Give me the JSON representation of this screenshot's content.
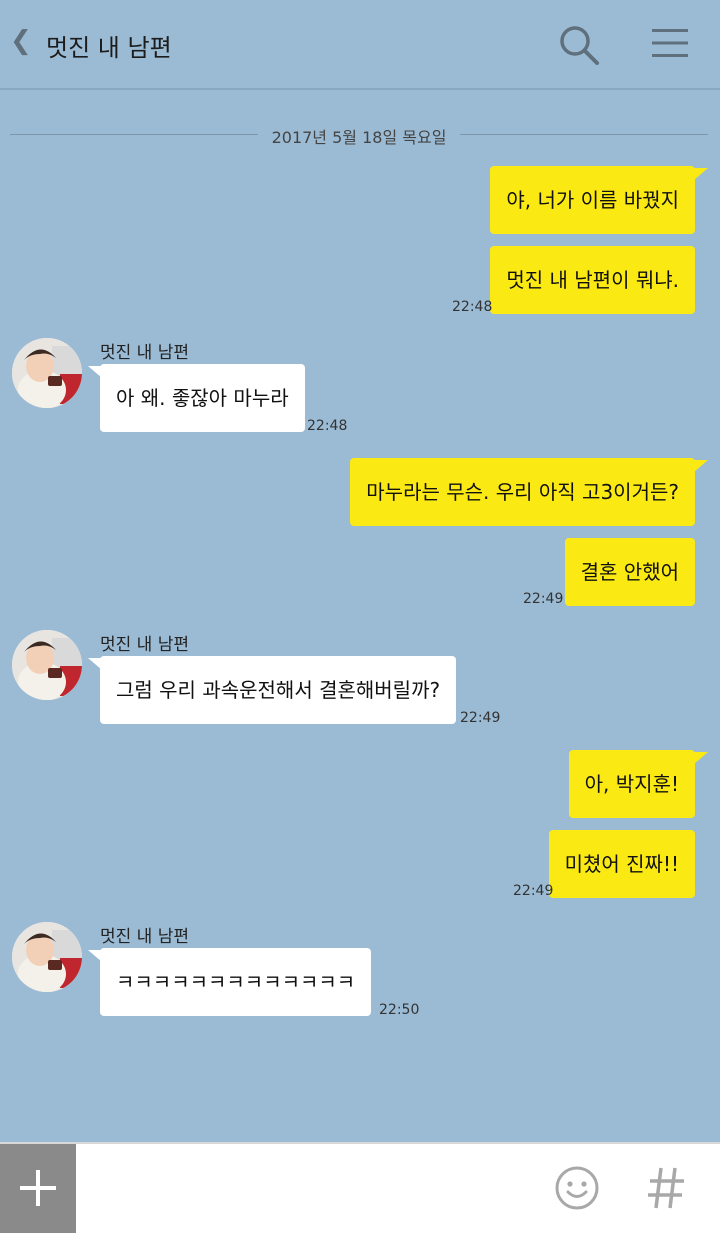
{
  "header": {
    "back_icon": "chevron-left-icon",
    "title": "멋진 내 남편",
    "search_icon": "search-icon",
    "menu_icon": "menu-icon"
  },
  "date_separator": "2017년 5월 18일 목요일",
  "messages": [
    {
      "sender": "me",
      "text": "야, 너가 이름 바꿨지"
    },
    {
      "sender": "me",
      "text": "멋진 내 남편이 뭐냐.",
      "time": "22:48"
    },
    {
      "sender": "other",
      "name": "멋진 내 남편",
      "text": "아 왜. 좋잖아 마누라",
      "time": "22:48"
    },
    {
      "sender": "me",
      "text": "마누라는 무슨. 우리 아직 고3이거든?"
    },
    {
      "sender": "me",
      "text": "결혼 안했어",
      "time": "22:49"
    },
    {
      "sender": "other",
      "name": "멋진 내 남편",
      "text": "그럼 우리 과속운전해서 결혼해버릴까?",
      "time": "22:49"
    },
    {
      "sender": "me",
      "text": "아, 박지훈!"
    },
    {
      "sender": "me",
      "text": "미쳤어 진짜!!",
      "time": "22:49"
    },
    {
      "sender": "other",
      "name": "멋진 내 남편",
      "text": "ㅋㅋㅋㅋㅋㅋㅋㅋㅋㅋㅋㅋㅋ",
      "time": "22:50"
    }
  ],
  "input_bar": {
    "plus_icon": "plus-icon",
    "placeholder": "",
    "emoji_icon": "emoji-icon",
    "hash_icon": "hash-icon"
  },
  "colors": {
    "background": "#9bbbd4",
    "my_bubble": "#fbe914",
    "other_bubble": "#ffffff"
  }
}
